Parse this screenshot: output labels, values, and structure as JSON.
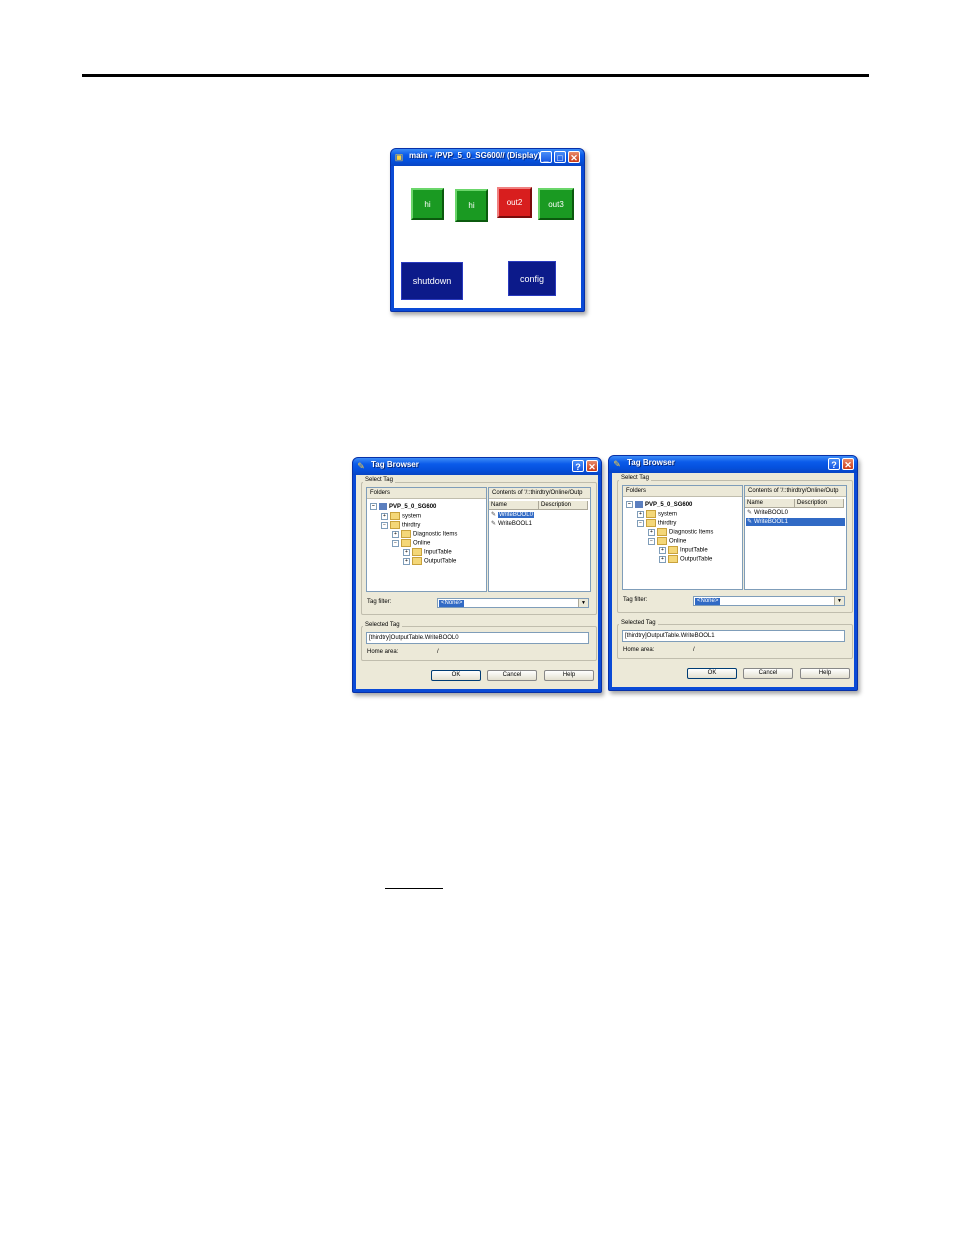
{
  "display_window": {
    "title": "main - /PVP_5_0_SG600// (Display)",
    "buttons": [
      {
        "label": "hi",
        "color": "#1a9a22"
      },
      {
        "label": "hi",
        "color": "#1a9a22"
      },
      {
        "label": "out2",
        "color": "#d81e1e"
      },
      {
        "label": "out3",
        "color": "#1a9a22"
      },
      {
        "label": "shutdown",
        "color": "#0c1a8a"
      },
      {
        "label": "config",
        "color": "#0c1a8a"
      }
    ]
  },
  "tag_browsers": [
    {
      "title": "Tag Browser",
      "select_tag_label": "Select Tag",
      "folders_header": "Folders",
      "contents_header": "Contents of '/::thirdtry/Online/Outp",
      "tree": {
        "root": "PVP_5_0_SG600",
        "system": "system",
        "thirdtry": "thirdtry",
        "diagnostic": "Diagnostic Items",
        "online": "Online",
        "input_table": "InputTable",
        "output_table": "OutputTable"
      },
      "columns": [
        "Name",
        "Description"
      ],
      "tags": [
        "WriteBOOL0",
        "WriteBOOL1"
      ],
      "selected_index": 0,
      "tag_filter_label": "Tag filter:",
      "tag_filter_value": "<None>",
      "selected_tag_group": "Selected Tag",
      "selected_tag_value": "[thirdtry]OutputTable.WriteBOOL0",
      "home_area_label": "Home area:",
      "home_area_value": "/",
      "ok": "OK",
      "cancel": "Cancel",
      "help": "Help"
    },
    {
      "title": "Tag Browser",
      "select_tag_label": "Select Tag",
      "folders_header": "Folders",
      "contents_header": "Contents of '/::thirdtry/Online/Outp",
      "tree": {
        "root": "PVP_5_0_SG600",
        "system": "system",
        "thirdtry": "thirdtry",
        "diagnostic": "Diagnostic Items",
        "online": "Online",
        "input_table": "InputTable",
        "output_table": "OutputTable"
      },
      "columns": [
        "Name",
        "Description"
      ],
      "tags": [
        "WriteBOOL0",
        "WriteBOOL1"
      ],
      "selected_index": 1,
      "tag_filter_label": "Tag filter:",
      "tag_filter_value": "<None>",
      "selected_tag_group": "Selected Tag",
      "selected_tag_value": "[thirdtry]OutputTable.WriteBOOL1",
      "home_area_label": "Home area:",
      "home_area_value": "/",
      "ok": "OK",
      "cancel": "Cancel",
      "help": "Help"
    }
  ]
}
